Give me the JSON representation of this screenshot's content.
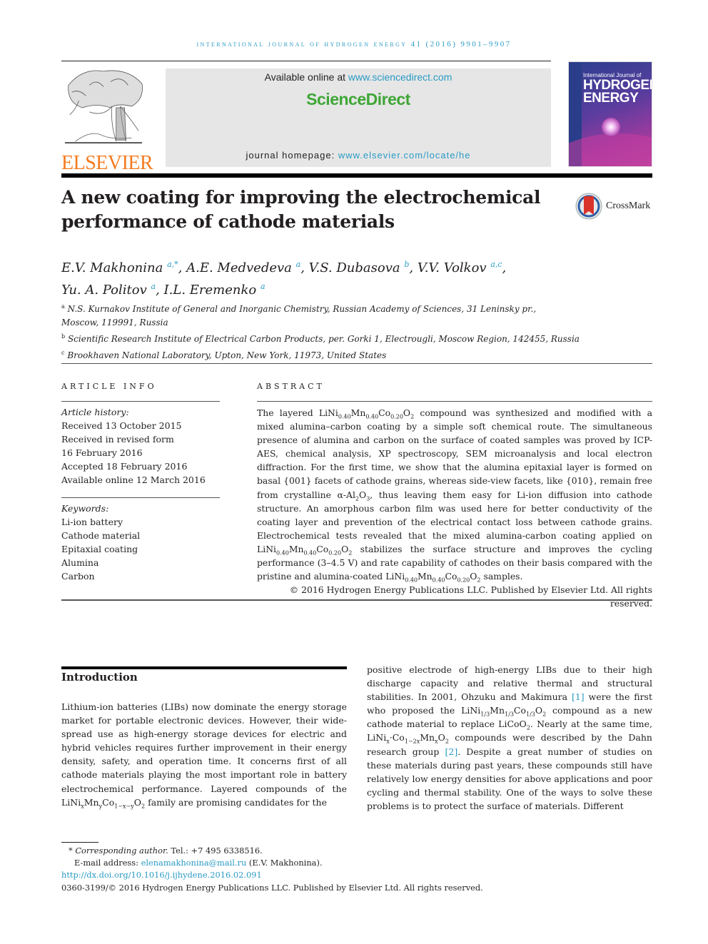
{
  "running_head": "International Journal of Hydrogen Energy 41 (2016) 9901–9907",
  "header": {
    "publisher_logo": "tree-icon",
    "publisher_name": "ELSEVIER",
    "available_prefix": "Available online at ",
    "available_link": "www.sciencedirect.com",
    "platform_name": "ScienceDirect",
    "homepage_prefix": "journal homepage: ",
    "homepage_link": "www.elsevier.com/locate/he",
    "cover": {
      "small_title": "International Journal of",
      "big_title_line1": "HYDROGEN",
      "big_title_line2": "ENERGY"
    },
    "colors": {
      "link": "#2a9bc4",
      "elsevier_orange": "#f47b20",
      "sciencedirect_green": "#3ea635"
    }
  },
  "article": {
    "title": "A new coating for improving the electrochemical performance of cathode materials",
    "crossmark_label": "CrossMark",
    "authors": [
      {
        "name": "E.V. Makhonina",
        "aff": "a,*"
      },
      {
        "name": "A.E. Medvedeva",
        "aff": "a"
      },
      {
        "name": "V.S. Dubasova",
        "aff": "b"
      },
      {
        "name": "V.V. Volkov",
        "aff": "a,c"
      },
      {
        "name": "Yu. A. Politov",
        "aff": "a"
      },
      {
        "name": "I.L. Eremenko",
        "aff": "a"
      }
    ],
    "affiliations": [
      {
        "key": "a",
        "line1": "N.S. Kurnakov Institute of General and Inorganic Chemistry, Russian Academy of Sciences, 31 Leninsky pr.,",
        "line2": "Moscow, 119991, Russia"
      },
      {
        "key": "b",
        "line1": "Scientific Research Institute of Electrical Carbon Products, per. Gorki 1, Electrougli, Moscow Region, 142455, Russia"
      },
      {
        "key": "c",
        "line1": "Brookhaven National Laboratory, Upton, New York, 11973, United States"
      }
    ]
  },
  "article_info": {
    "heading": "ARTICLE INFO",
    "history_label": "Article history:",
    "history": [
      "Received 13 October 2015",
      "Received in revised form",
      "16 February 2016",
      "Accepted 18 February 2016",
      "Available online 12 March 2016"
    ],
    "keywords_label": "Keywords:",
    "keywords": [
      "Li-ion battery",
      "Cathode material",
      "Epitaxial coating",
      "Alumina",
      "Carbon"
    ]
  },
  "abstract": {
    "heading": "ABSTRACT",
    "parts": {
      "p1": "The layered ",
      "f1": "LiNi",
      "p2": " compound was synthesized and modified with a mixed alumina–carbon coating by a simple soft chemical route. The simultaneous presence of alumina and carbon on the surface of coated samples was proved by ICP-AES, chemical analysis, XP spectroscopy, SEM microanalysis and local electron diffraction. For the first time, we show that the alumina epitaxial layer is formed on basal {001} facets of cathode grains, whereas side-view facets, like {010}, remain free from crystalline α-Al",
      "p3": ", thus leaving them easy for Li-ion diffusion into cathode structure. An amorphous carbon film was used here for better conductivity of the coating layer and prevention of the electrical contact loss between cathode grains. Electrochemical tests revealed that the mixed alumina-carbon coating applied on ",
      "p4": " stabilizes the surface structure and improves the cycling performance (3–4.5 V) and rate capability of cathodes on their basis compared with the pristine and alumina-coated ",
      "p5": " samples."
    },
    "copyright": "© 2016 Hydrogen Energy Publications LLC. Published by Elsevier Ltd. All rights reserved."
  },
  "introduction": {
    "heading": "Introduction",
    "left_text": "Lithium-ion batteries (LIBs) now dominate the energy storage market for portable electronic devices. However, their wide-spread use as high-energy storage devices for electric and hybrid vehicles requires further improvement in their energy density, safety, and operation time. It concerns first of all cathode materials playing the most important role in battery electrochemical performance. Layered compounds of the ",
    "left_tail": " family are promising candidates for the",
    "right": {
      "t1": "positive electrode of high-energy LIBs due to their high discharge capacity and relative thermal and structural stabilities. In 2001, Ohzuku and Makimura ",
      "ref1": "[1]",
      "t2": " were the first who proposed the ",
      "t3": " compound as a new cathode material to replace LiCoO",
      "t4": ". Nearly at the same time, LiNi",
      "t5": " compounds were described by the Dahn research group ",
      "ref2": "[2]",
      "t6": ". Despite a great number of studies on these materials during past years, these compounds still have relatively low energy densities for above applications and poor cycling and thermal stability. One of the ways to solve these problems is to protect the surface of materials. Different"
    }
  },
  "footnotes": {
    "corresponding_label": "Corresponding author.",
    "tel": " Tel.: +7 495 6338516.",
    "email_label": "E-mail address: ",
    "email": "elenamakhonina@mail.ru",
    "email_owner": " (E.V. Makhonina).",
    "doi": "http://dx.doi.org/10.1016/j.ijhydene.2016.02.091",
    "issn_copyright": "0360-3199/© 2016 Hydrogen Energy Publications LLC. Published by Elsevier Ltd. All rights reserved."
  }
}
